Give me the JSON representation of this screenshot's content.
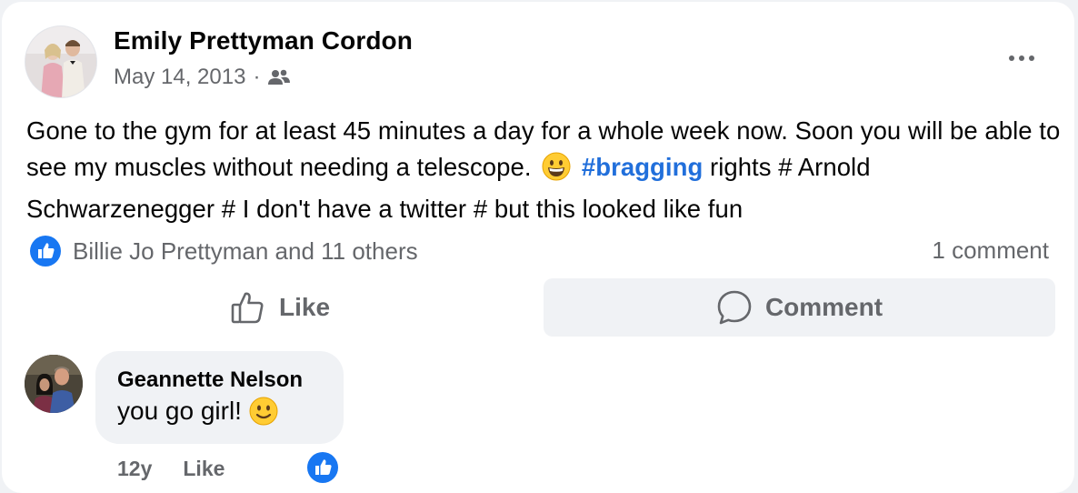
{
  "post": {
    "author": "Emily Prettyman Cordon",
    "date": "May 14, 2013",
    "separator": "·",
    "audience_icon": "friends-icon",
    "text_part1": "Gone to the gym for at least 45 minutes a day for a whole week now. Soon you will be able to see my muscles without needing a telescope.",
    "emoji": "grinning-face",
    "hashtag": "#bragging",
    "text_part2": "rights # Arnold Schwarzenegger # I don't have a twitter # but this looked like fun"
  },
  "reactions": {
    "summary": "Billie Jo Prettyman and 11 others",
    "comment_count": "1 comment"
  },
  "actions": {
    "like_label": "Like",
    "comment_label": "Comment"
  },
  "comment": {
    "author": "Geannette Nelson",
    "text": "you go girl!",
    "emoji": "slightly-smiling-face",
    "age": "12y",
    "like_label": "Like"
  },
  "colors": {
    "accent_blue": "#216fdb",
    "like_blue": "#1877f2",
    "secondary_text": "#65676b",
    "bubble_bg": "#f0f2f5"
  }
}
